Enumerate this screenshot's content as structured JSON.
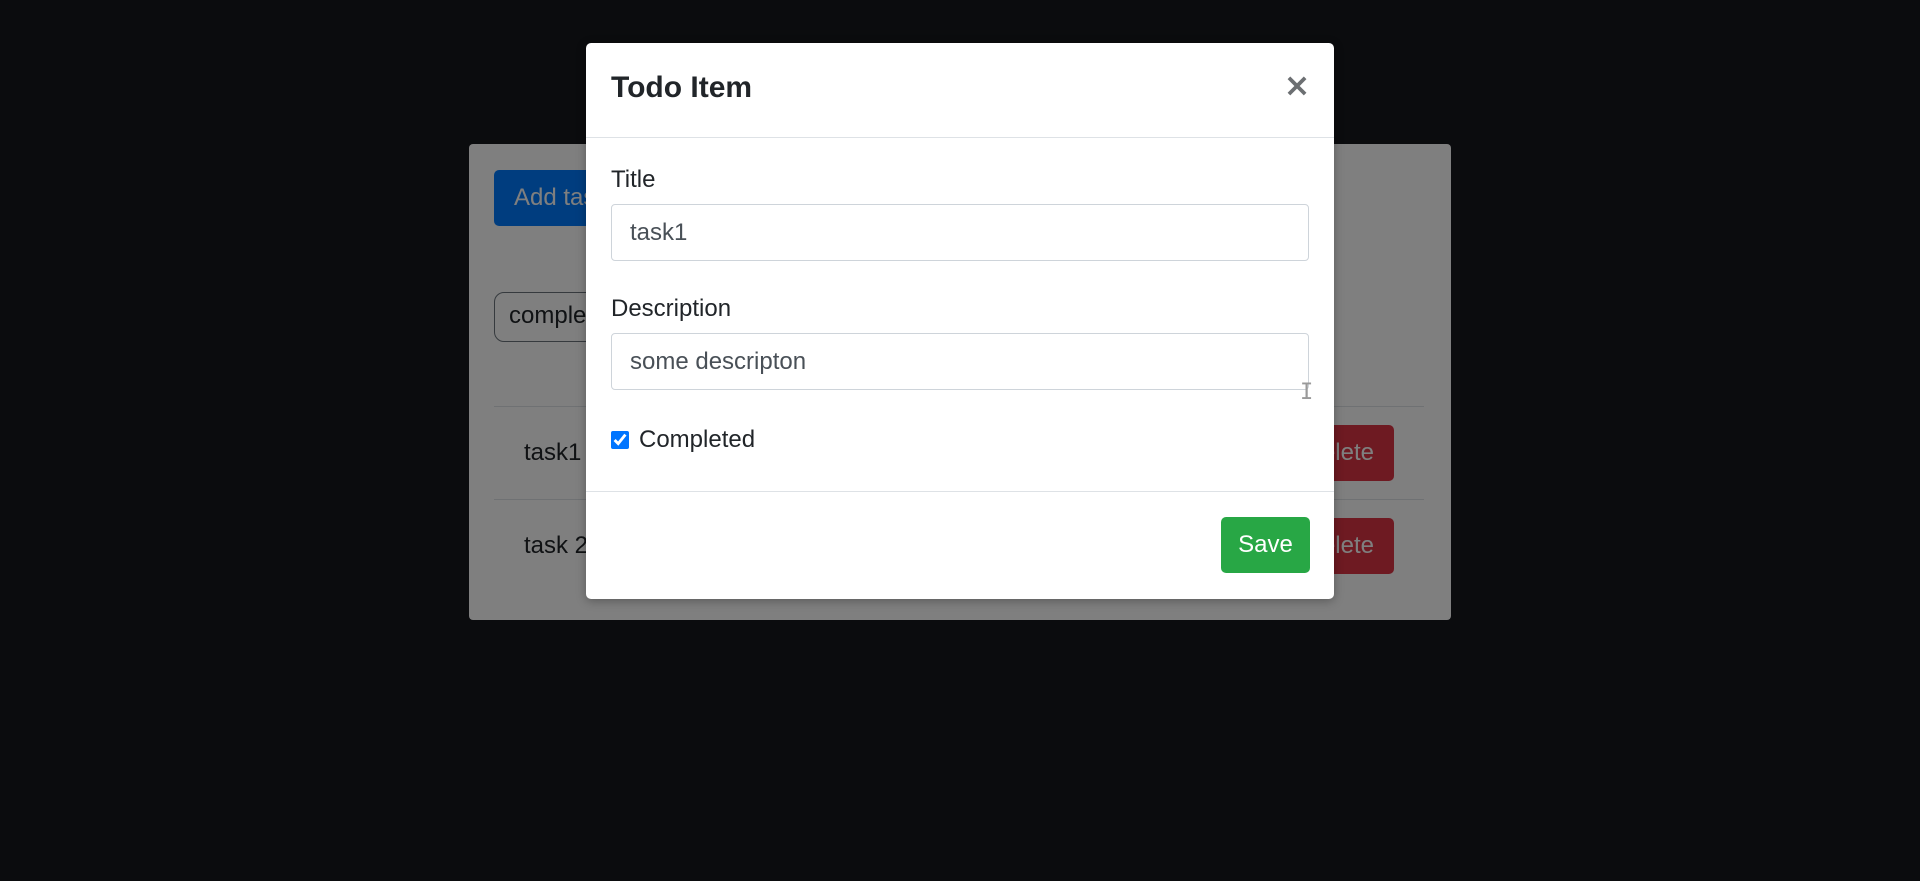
{
  "background_app": {
    "add_button_label": "Add task",
    "filter_select_value": "completed",
    "todos": [
      {
        "title": "task1",
        "delete_label": "Delete"
      },
      {
        "title": "task 2",
        "delete_label": "Delete"
      }
    ]
  },
  "modal": {
    "title": "Todo Item",
    "close_glyph": "×",
    "title_label": "Title",
    "title_value": "task1",
    "description_label": "Description",
    "description_value": "some descripton",
    "completed_label": "Completed",
    "completed_checked": true,
    "save_label": "Save"
  },
  "colors": {
    "primary": "#007bff",
    "danger": "#dc3545",
    "success": "#28a745",
    "page_background": "#16181d"
  }
}
